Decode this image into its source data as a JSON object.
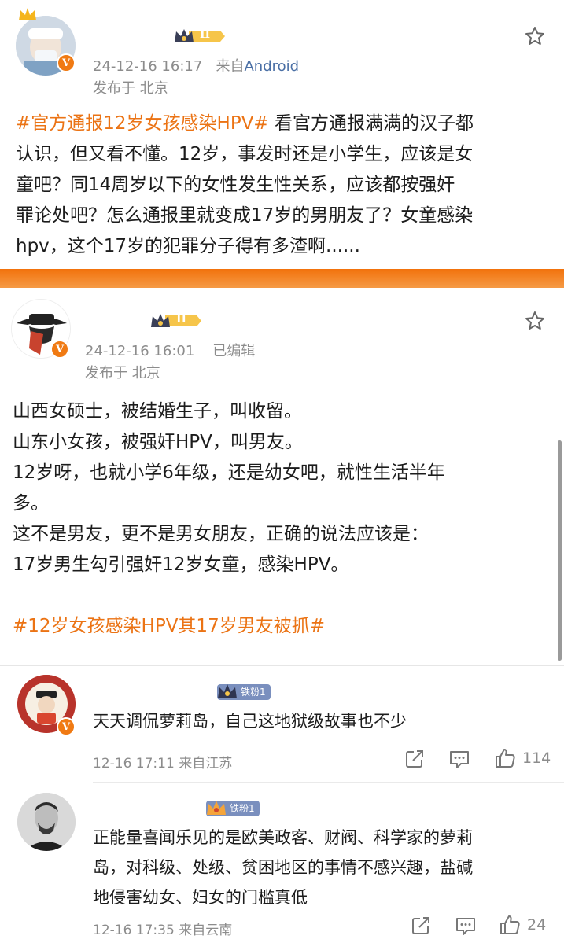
{
  "post1": {
    "date": "24-12-16 16:17",
    "source_prefix": "来自",
    "source": "Android",
    "location": "发布于 北京",
    "level": "II",
    "hashtag": "#官方通报12岁女孩感染HPV#",
    "lines": [
      "看官方通报满满的汉子都",
      "认识，但又看不懂。12岁，事发时还是小学生，应该是女",
      "童吧？同14周岁以下的女性发生性关系，应该都按强奸",
      "罪论处吧？怎么通报里就变成17岁的男朋友了？女童感染",
      "hpv，这个17岁的犯罪分子得有多渣啊......"
    ]
  },
  "post2": {
    "date": "24-12-16 16:01",
    "edited": "已编辑",
    "location": "发布于 北京",
    "level": "II",
    "lines": [
      "山西女硕士，被结婚生子，叫收留。",
      "山东小女孩，被强奸HPV，叫男友。",
      "12岁呀，也就小学6年级，还是幼女吧，就性生活半年",
      "多。",
      "这不是男友，更不是男女朋友，正确的说法应该是：",
      "17岁男生勾引强奸12岁女童，感染HPV。"
    ],
    "hashtag": "#12岁女孩感染HPV其17岁男友被抓#"
  },
  "comments": [
    {
      "fan_label": "铁粉1",
      "text_lines": [
        "天天调侃萝莉岛，自己这地狱级故事也不少"
      ],
      "meta": "12-16 17:11 来自江苏",
      "likes": "114"
    },
    {
      "fan_label": "铁粉1",
      "text_lines": [
        "正能量喜闻乐见的是欧美政客、财阀、科学家的萝莉",
        "岛，对科级、处级、贫困地区的事情不感兴趣，盐碱",
        "地侵害幼女、妇女的门槛真低"
      ],
      "meta": "12-16 17:35 来自云南",
      "likes": "24"
    }
  ],
  "colors": {
    "accent": "#eb7314",
    "link": "#4a6fa5",
    "muted": "#8c8c8c",
    "fan_badge": "#7a8fbe"
  },
  "icons": [
    "crown-icon",
    "star-icon",
    "share-icon",
    "comment-icon",
    "like-icon",
    "verified-icon"
  ]
}
